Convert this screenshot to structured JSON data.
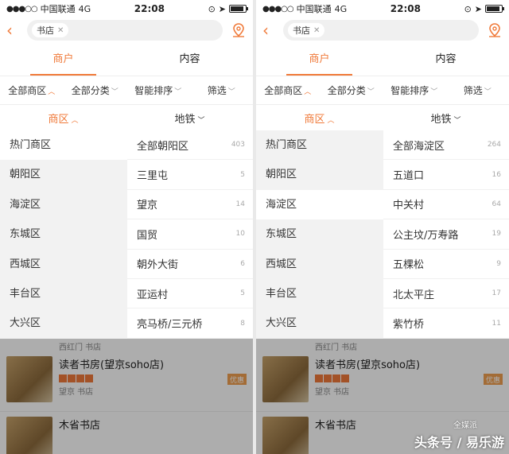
{
  "screens": [
    {
      "status": {
        "carrier": "中国联通",
        "network": "4G",
        "time": "22:08"
      },
      "search": {
        "chip": "书店"
      },
      "tabs": [
        "商户",
        "内容"
      ],
      "filters": [
        "全部商区",
        "全部分类",
        "智能排序",
        "筛选"
      ],
      "subtabs": [
        "商区",
        "地铁"
      ],
      "left": [
        "热门商区",
        "朝阳区",
        "海淀区",
        "东城区",
        "西城区",
        "丰台区",
        "大兴区"
      ],
      "left_active": 0,
      "right": [
        {
          "name": "全部朝阳区",
          "count": "403"
        },
        {
          "name": "三里屯",
          "count": "5"
        },
        {
          "name": "望京",
          "count": "14"
        },
        {
          "name": "国贸",
          "count": "10"
        },
        {
          "name": "朝外大街",
          "count": "6"
        },
        {
          "name": "亚运村",
          "count": "5"
        },
        {
          "name": "亮马桥/三元桥",
          "count": "8"
        }
      ],
      "list": {
        "row0_meta": "西红门  书店",
        "item1": {
          "name": "读者书房(望京soho店)",
          "meta": "望京  书店",
          "badge": "优惠"
        },
        "item2": {
          "name": "木省书店"
        }
      }
    },
    {
      "status": {
        "carrier": "中国联通",
        "network": "4G",
        "time": "22:08"
      },
      "search": {
        "chip": "书店"
      },
      "tabs": [
        "商户",
        "内容"
      ],
      "filters": [
        "全部商区",
        "全部分类",
        "智能排序",
        "筛选"
      ],
      "subtabs": [
        "商区",
        "地铁"
      ],
      "left": [
        "热门商区",
        "朝阳区",
        "海淀区",
        "东城区",
        "西城区",
        "丰台区",
        "大兴区"
      ],
      "left_active": 2,
      "right": [
        {
          "name": "全部海淀区",
          "count": "264"
        },
        {
          "name": "五道口",
          "count": "16"
        },
        {
          "name": "中关村",
          "count": "64"
        },
        {
          "name": "公主坟/万寿路",
          "count": "19"
        },
        {
          "name": "五棵松",
          "count": "9"
        },
        {
          "name": "北太平庄",
          "count": "17"
        },
        {
          "name": "紫竹桥",
          "count": "11"
        }
      ],
      "list": {
        "row0_meta": "西红门  书店",
        "item1": {
          "name": "读者书房(望京soho店)",
          "meta": "望京  书店",
          "badge": "优惠"
        },
        "item2": {
          "name": "木省书店"
        }
      }
    }
  ],
  "watermark": {
    "text": "头条号 / 易乐游",
    "small": "全媒派"
  },
  "colors": {
    "accent": "#f07a3a"
  }
}
